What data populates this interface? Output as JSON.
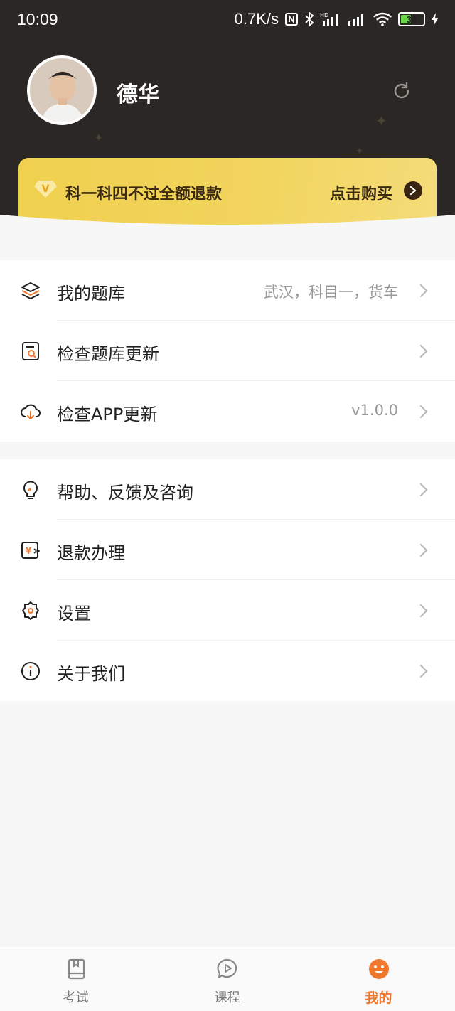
{
  "status_bar": {
    "time": "10:09",
    "network_speed": "0.7K/s",
    "battery": "38",
    "icons": [
      "nfc-icon",
      "bluetooth-icon",
      "hd-signal-icon",
      "signal-icon",
      "wifi-icon",
      "battery-icon",
      "charging-icon"
    ]
  },
  "profile": {
    "username": "德华",
    "refresh_icon": "refresh-icon"
  },
  "vip_banner": {
    "badge": "V",
    "text": "科一科四不过全额退款",
    "cta": "点击购买"
  },
  "menu_group_1": [
    {
      "label": "我的题库",
      "value": "武汉，科目一，货车",
      "icon": "layers-icon"
    },
    {
      "label": "检查题库更新",
      "value": "",
      "icon": "doc-search-icon"
    },
    {
      "label": "检查APP更新",
      "value": "v1.0.0",
      "icon": "cloud-download-icon"
    }
  ],
  "menu_group_2": [
    {
      "label": "帮助、反馈及咨询",
      "value": "",
      "icon": "lightbulb-icon"
    },
    {
      "label": "退款办理",
      "value": "",
      "icon": "refund-icon"
    },
    {
      "label": "设置",
      "value": "",
      "icon": "gear-icon"
    },
    {
      "label": "关于我们",
      "value": "",
      "icon": "info-icon"
    }
  ],
  "bottom_nav": [
    {
      "label": "考试",
      "icon": "exam-book-icon",
      "active": false
    },
    {
      "label": "课程",
      "icon": "course-play-icon",
      "active": false
    },
    {
      "label": "我的",
      "icon": "profile-smile-icon",
      "active": true
    }
  ],
  "colors": {
    "header_bg": "#2a2725",
    "vip_gold": "#f0d04e",
    "accent": "#f0772b"
  }
}
